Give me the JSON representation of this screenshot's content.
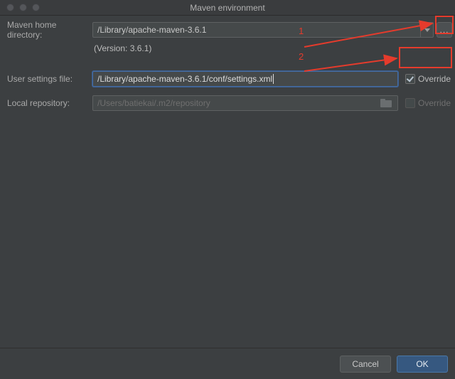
{
  "window": {
    "title": "Maven environment"
  },
  "labels": {
    "maven_home": "Maven home directory:",
    "user_settings": "User settings file:",
    "local_repo": "Local repository:",
    "override": "Override",
    "version": "(Version: 3.6.1)"
  },
  "fields": {
    "maven_home_value": "/Library/apache-maven-3.6.1",
    "user_settings_value": "/Library/apache-maven-3.6.1/conf/settings.xml",
    "local_repo_placeholder": "/Users/batiekai/.m2/repository"
  },
  "overrides": {
    "user_settings_checked": true,
    "local_repo_checked": false
  },
  "buttons": {
    "browse": "...",
    "cancel": "Cancel",
    "ok": "OK"
  },
  "annotations": {
    "num1": "1",
    "num2": "2"
  }
}
